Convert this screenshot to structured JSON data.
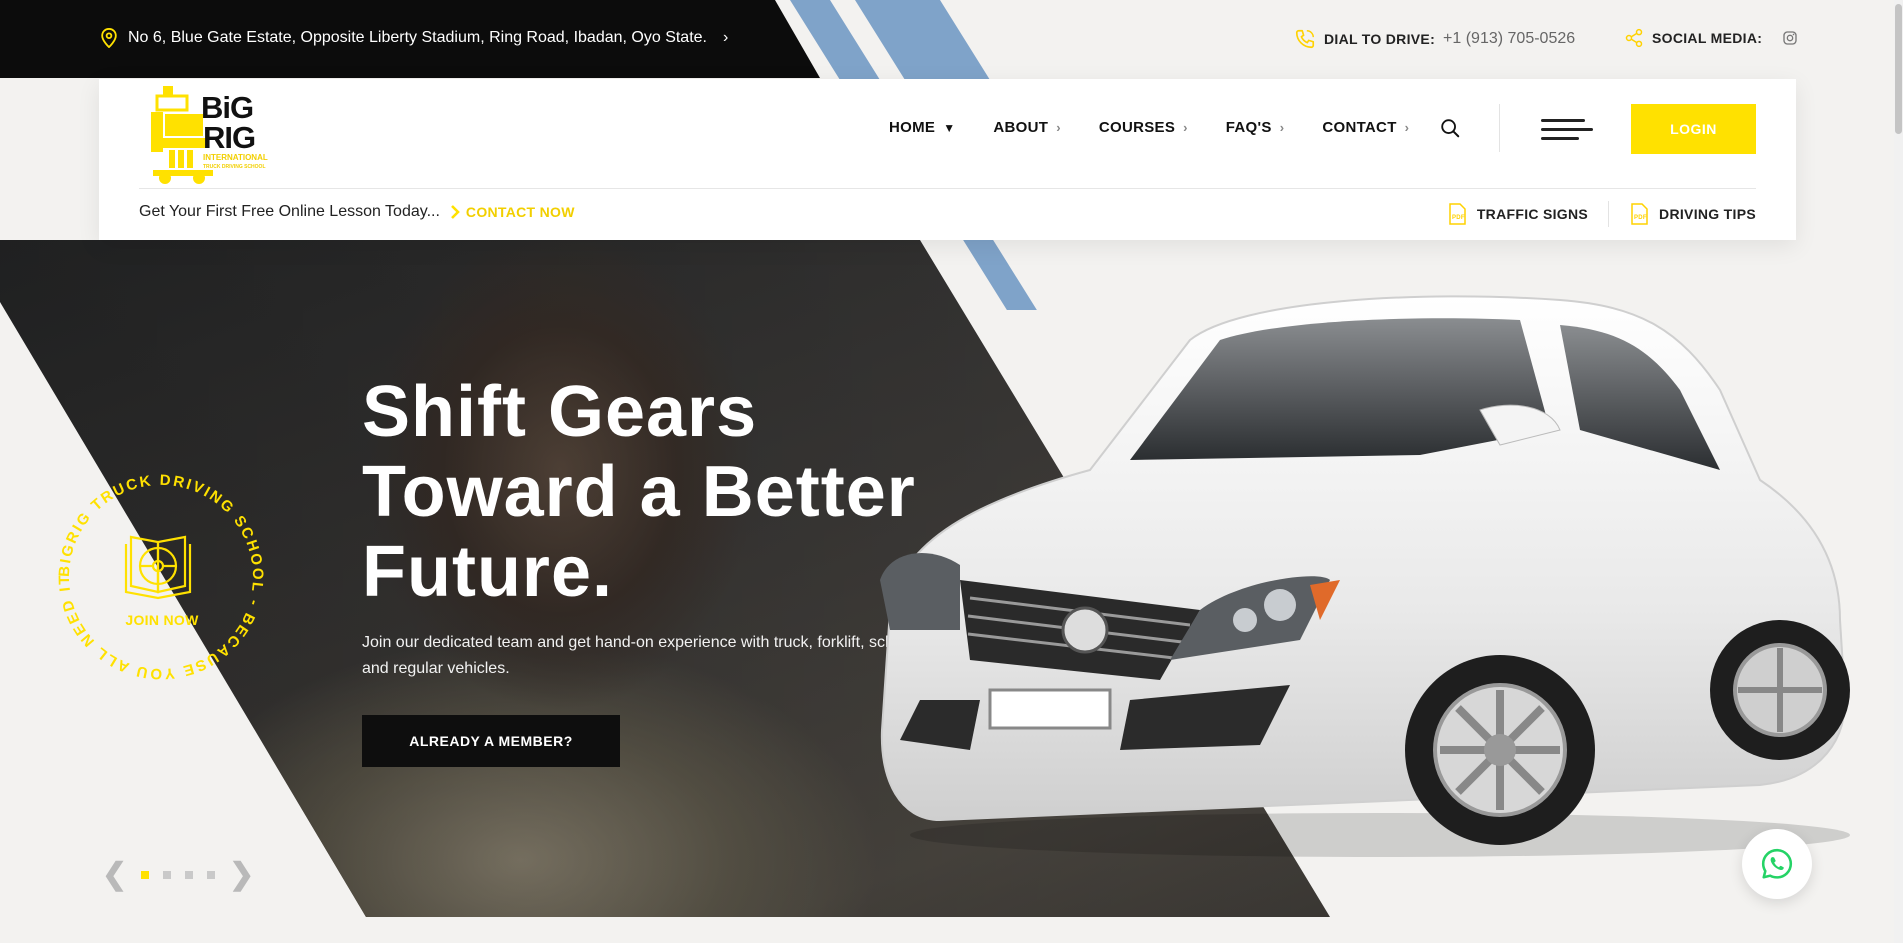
{
  "topbar": {
    "address": "No 6, Blue Gate Estate, Opposite Liberty Stadium, Ring Road, Ibadan, Oyo State.",
    "dial_label": "DIAL TO DRIVE:",
    "dial_number": "+1 (913) 705-0526",
    "social_label": "SOCIAL MEDIA:"
  },
  "logo": {
    "line1": "BiG",
    "line2": "RIG",
    "sub1": "INTERNATIONAL",
    "sub2": "TRUCK DRIVING SCHOOL"
  },
  "nav": {
    "items": [
      {
        "label": "HOME"
      },
      {
        "label": "ABOUT"
      },
      {
        "label": "COURSES"
      },
      {
        "label": "FAQ'S"
      },
      {
        "label": "CONTACT"
      }
    ],
    "login_label": "LOGIN"
  },
  "promo": {
    "text": "Get Your First Free Online Lesson Today...",
    "cta": "CONTACT NOW"
  },
  "resources": {
    "traffic_signs": "TRAFFIC SIGNS",
    "driving_tips": "DRIVING TIPS"
  },
  "hero": {
    "title_line1": "Shift Gears",
    "title_line2": "Toward a Better",
    "title_line3": "Future.",
    "description": "Join our dedicated team and get hand-on experience with truck, forklift, school bus and regular vehicles.",
    "button_label": "ALREADY A MEMBER?"
  },
  "badge": {
    "ring_text": "BIGRIG TRUCK DRIVING SCHOOL - BECAUSE YOU ALL NEED IT - ",
    "join_label": "JOIN NOW"
  },
  "slider": {
    "active_index": 0,
    "count": 4
  },
  "colors": {
    "accent": "#ffe100",
    "dark": "#0c0c0c",
    "stripe": "#7fa3c9",
    "whatsapp": "#25d366"
  }
}
